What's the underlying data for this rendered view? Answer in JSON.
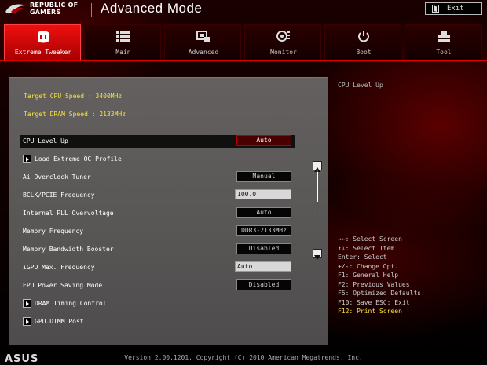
{
  "header": {
    "brand_line1": "REPUBLIC OF",
    "brand_line2": "GAMERS",
    "mode_title": "Advanced Mode",
    "exit_label": "Exit"
  },
  "tabs": [
    {
      "label": "Extreme Tweaker",
      "icon": "tweaker-cup-icon",
      "active": true
    },
    {
      "label": "Main",
      "icon": "list-icon",
      "active": false
    },
    {
      "label": "Advanced",
      "icon": "advanced-chip-icon",
      "active": false
    },
    {
      "label": "Monitor",
      "icon": "monitor-fan-icon",
      "active": false
    },
    {
      "label": "Boot",
      "icon": "power-icon",
      "active": false
    },
    {
      "label": "Tool",
      "icon": "tool-icon",
      "active": false
    }
  ],
  "main": {
    "target_cpu": "Target CPU Speed : 3400MHz",
    "target_dram": "Target DRAM Speed : 2133MHz",
    "rows": [
      {
        "label": "CPU Level Up",
        "value": "Auto",
        "type": "select",
        "selected": true
      },
      {
        "label": "Load Extreme OC Profile",
        "type": "submenu"
      },
      {
        "label": "Ai Overclock Tuner",
        "value": "Manual",
        "type": "select"
      },
      {
        "label": "BCLK/PCIE Frequency",
        "value": "100.0",
        "type": "input"
      },
      {
        "label": "Internal PLL Overvoltage",
        "value": "Auto",
        "type": "select"
      },
      {
        "label": "Memory Frequency",
        "value": "DDR3-2133MHz",
        "type": "select"
      },
      {
        "label": "Memory Bandwidth Booster",
        "value": "Disabled",
        "type": "select"
      },
      {
        "label": "iGPU Max. Frequency",
        "value": "Auto",
        "type": "input"
      },
      {
        "label": "EPU Power Saving Mode",
        "value": "Disabled",
        "type": "select"
      },
      {
        "label": "DRAM Timing Control",
        "type": "submenu"
      },
      {
        "label": "GPU.DIMM Post",
        "type": "submenu"
      }
    ]
  },
  "help": {
    "title": "CPU Level Up"
  },
  "hints": [
    {
      "text": "→←: Select Screen",
      "highlight": false
    },
    {
      "text": "↑↓: Select Item",
      "highlight": false
    },
    {
      "text": "Enter: Select",
      "highlight": false
    },
    {
      "text": "+/-: Change Opt.",
      "highlight": false
    },
    {
      "text": "F1: General Help",
      "highlight": false
    },
    {
      "text": "F2: Previous Values",
      "highlight": false
    },
    {
      "text": "F5: Optimized Defaults",
      "highlight": false
    },
    {
      "text": "F10: Save  ESC: Exit",
      "highlight": false
    },
    {
      "text": "F12: Print Screen",
      "highlight": true
    }
  ],
  "footer": {
    "brand": "ASUS",
    "version": "Version 2.00.1201. Copyright (C) 2010 American Megatrends, Inc."
  },
  "colors": {
    "accent_red": "#e00000",
    "highlight_yellow": "#f4e23a",
    "panel_gray": "#5e5b5b"
  }
}
